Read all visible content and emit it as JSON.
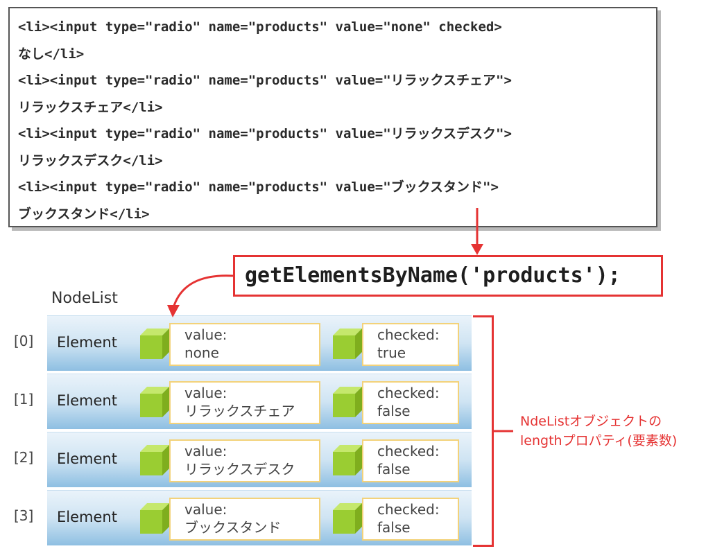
{
  "code_lines": [
    "<li><input type=\"radio\" name=\"products\" value=\"none\" checked>",
    "なし</li>",
    "<li><input type=\"radio\" name=\"products\" value=\"リラックスチェア\">",
    "リラックスチェア</li>",
    "<li><input type=\"radio\" name=\"products\" value=\"リラックスデスク\">",
    "リラックスデスク</li>",
    "<li><input type=\"radio\" name=\"products\" value=\"ブックスタンド\">",
    "ブックスタンド</li>"
  ],
  "call": "getElementsByName('products');",
  "nodelist_title": "NodeList",
  "rows": [
    {
      "index": "[0]",
      "label": "Element",
      "value_key": "value:",
      "value": "none",
      "checked_key": "checked:",
      "checked": "true"
    },
    {
      "index": "[1]",
      "label": "Element",
      "value_key": "value:",
      "value": "リラックスチェア",
      "checked_key": "checked:",
      "checked": "false"
    },
    {
      "index": "[2]",
      "label": "Element",
      "value_key": "value:",
      "value": "リラックスデスク",
      "checked_key": "checked:",
      "checked": "false"
    },
    {
      "index": "[3]",
      "label": "Element",
      "value_key": "value:",
      "value": "ブックスタンド",
      "checked_key": "checked:",
      "checked": "false"
    }
  ],
  "note_lines": [
    "NdeListオブジェクトの",
    "lengthプロパティ(要素数)"
  ],
  "colors": {
    "accent_red": "#e53333",
    "cube_green": "#9acd32",
    "prop_border": "#f3d27a"
  }
}
